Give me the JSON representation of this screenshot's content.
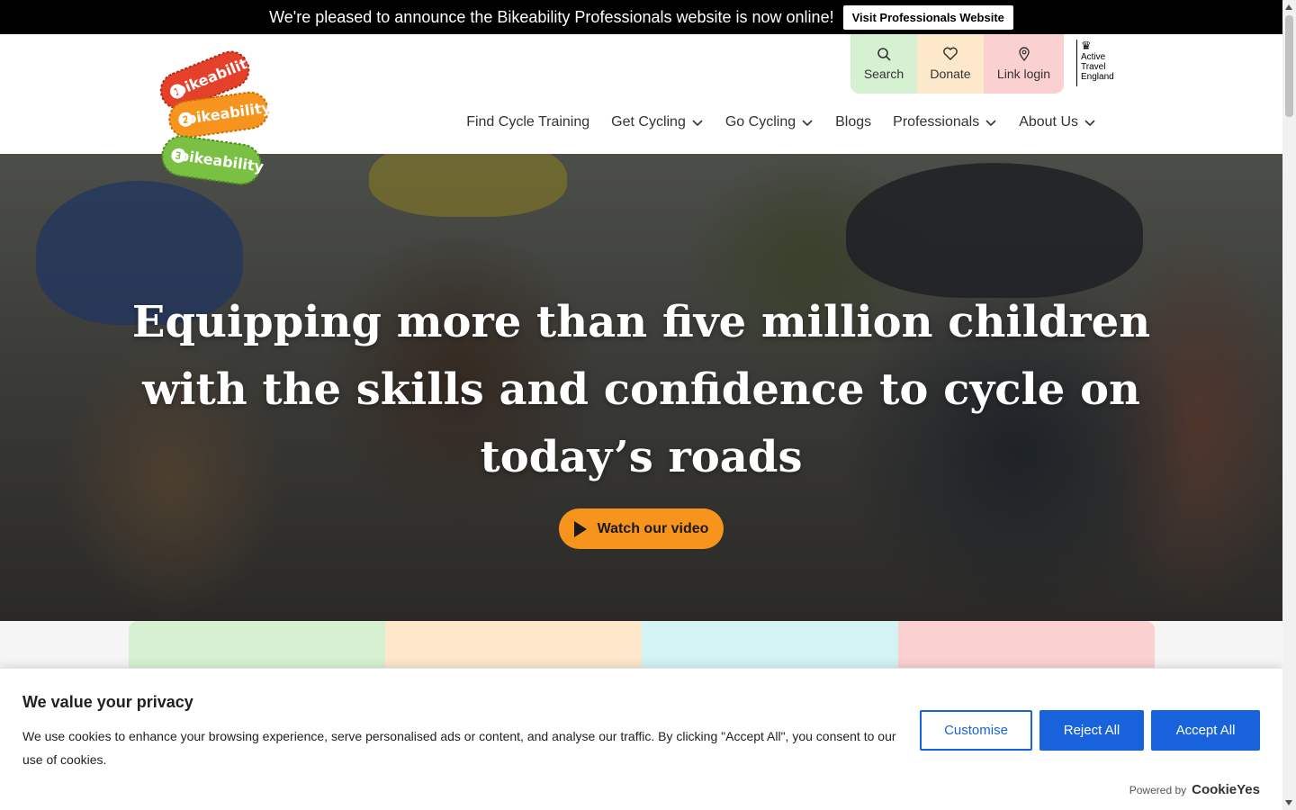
{
  "announcement": {
    "text": "We're pleased to announce the Bikeability Professionals website is now online!",
    "button_label": "Visit Professionals Website"
  },
  "header": {
    "logo": {
      "levels": [
        "1",
        "2",
        "3"
      ],
      "wordmark": "bikeability",
      "colors": [
        "#e4402a",
        "#f7941d",
        "#7ac143"
      ]
    },
    "utility": [
      {
        "label": "Search",
        "icon": "search-icon"
      },
      {
        "label": "Donate",
        "icon": "heart-icon"
      },
      {
        "label": "Link login",
        "icon": "location-pin-icon"
      }
    ],
    "partner": {
      "lines": [
        "Active",
        "Travel",
        "England"
      ]
    },
    "nav": [
      {
        "label": "Find Cycle Training"
      },
      {
        "label": "Get Cycling",
        "has_dropdown": true
      },
      {
        "label": "Go Cycling",
        "has_dropdown": true
      },
      {
        "label": "Blogs"
      },
      {
        "label": "Professionals",
        "has_dropdown": true
      },
      {
        "label": "About Us",
        "has_dropdown": true
      }
    ]
  },
  "hero": {
    "title_lines": [
      "Equipping more than five million children",
      "with the skills and confidence to cycle on",
      "today’s roads"
    ],
    "video_button": "Watch our video"
  },
  "cookie": {
    "title": "We value your privacy",
    "description": "We use cookies to enhance your browsing experience, serve personalised ads or content, and analyse our traffic. By clicking \"Accept All\", you consent to our use of cookies.",
    "customise": "Customise",
    "reject": "Reject All",
    "accept": "Accept All",
    "powered_by": "Powered by",
    "brand": "CookieYes"
  },
  "colors": {
    "accent_orange": "#f7941d",
    "cookie_blue": "#1863dc",
    "tile_green": "#d6f1d2",
    "tile_peach": "#fde8cb",
    "tile_cyan": "#d4f3f5",
    "tile_pink": "#fbd0d0"
  }
}
